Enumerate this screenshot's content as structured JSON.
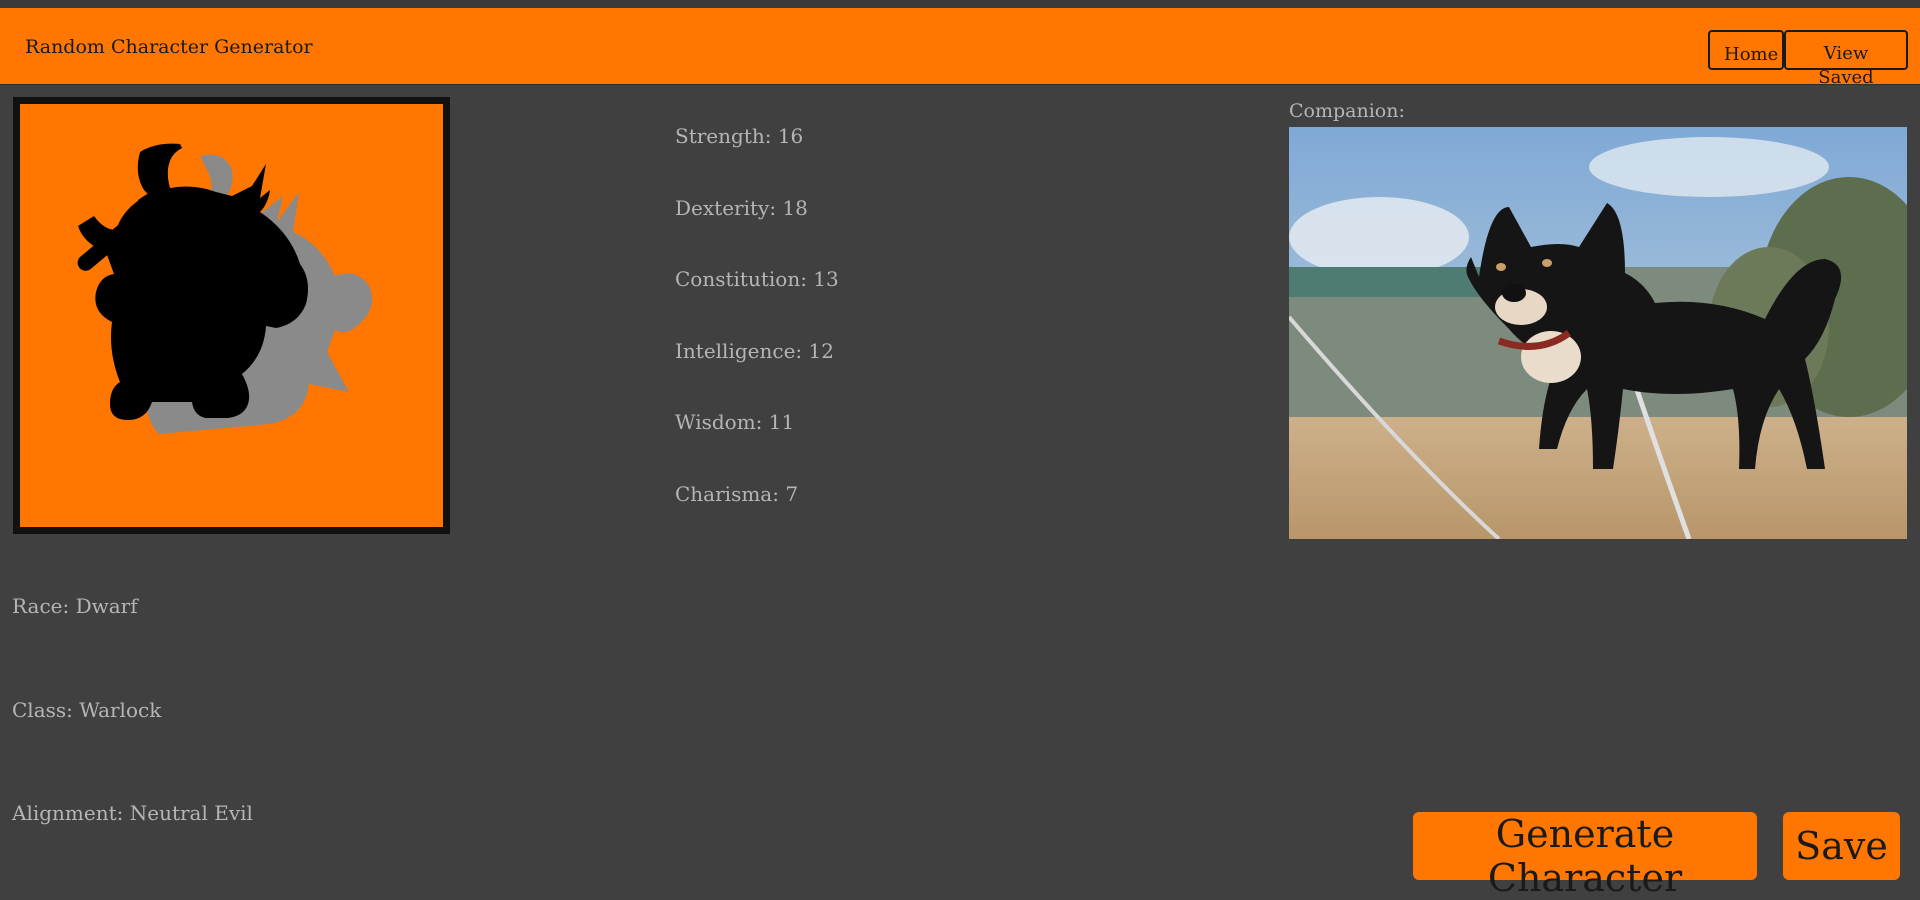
{
  "app": {
    "brand": "Random Character Generator"
  },
  "nav": {
    "home_label": "Home",
    "saved_label": "View Saved"
  },
  "character": {
    "portrait_icon": "dwarf-warrior-silhouette",
    "race": "Race: Dwarf",
    "class": "Class: Warlock",
    "alignment": "Alignment: Neutral Evil"
  },
  "stats": [
    "Strength: 16",
    "Dexterity: 18",
    "Constitution: 13",
    "Intelligence: 12",
    "Wisdom: 11",
    "Charisma: 7"
  ],
  "companion": {
    "label": "Companion:",
    "photo_subject": "shiba-inu-dog"
  },
  "actions": {
    "generate_label": "Generate Character",
    "save_label": "Save"
  },
  "colors": {
    "accent": "#ff7600",
    "background": "#404040",
    "text": "#b5b5b5",
    "dark": "#1a1a1a"
  }
}
